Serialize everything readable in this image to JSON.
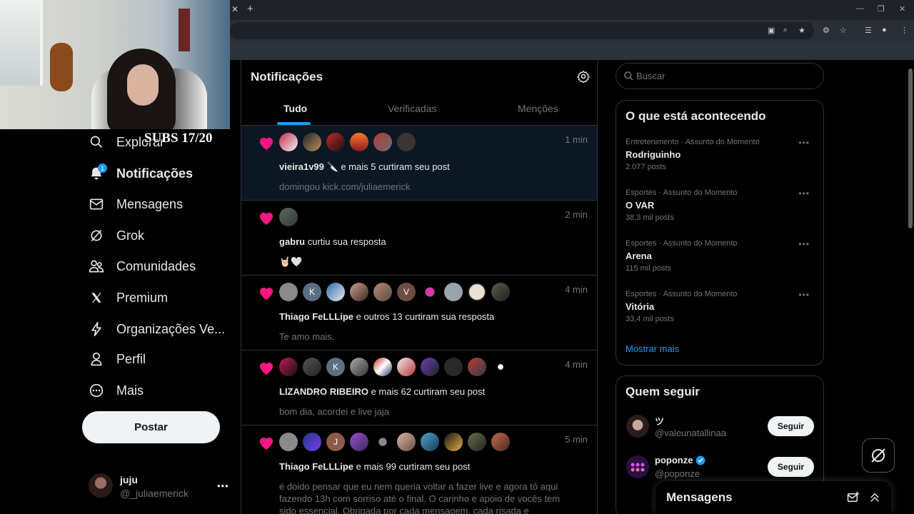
{
  "overlay": {
    "subs": "SUBS 17/20"
  },
  "nav": {
    "explore": "Explorar",
    "notifications": "Notificações",
    "notifications_badge": "1",
    "messages": "Mensagens",
    "grok": "Grok",
    "communities": "Comunidades",
    "premium": "Premium",
    "organizations": "Organizações Ve...",
    "profile": "Perfil",
    "more": "Mais",
    "post_button": "Postar"
  },
  "account": {
    "name": "juju",
    "handle": "@_juliaemerick"
  },
  "main": {
    "title": "Notificações",
    "tabs": [
      "Tudo",
      "Verificadas",
      "Menções"
    ]
  },
  "notifications": [
    {
      "time": "1 min",
      "actor": "vieira1v99",
      "emoji": "🔪",
      "action": " e mais 5 curtiram seu post",
      "sub": "domingou kick.com/juliaemerick"
    },
    {
      "time": "2 min",
      "actor": "gabru",
      "action": " curtiu sua resposta",
      "sub": "🤘🏻🤍"
    },
    {
      "time": "4 min",
      "actor": "Thiago FeLLLipe",
      "action": " e outros 13 curtiram sua resposta",
      "sub": "Te amo mais.",
      "avatar_letters": [
        "K",
        "V"
      ]
    },
    {
      "time": "4 min",
      "actor": "LIZANDRO RIBEIRO",
      "action": " e mais 62 curtiram seu post",
      "sub": "bom dia, acordei e live jaja",
      "avatar_letters": [
        "K"
      ]
    },
    {
      "time": "5 min",
      "actor": "Thiago FeLLLipe",
      "action": " e mais 99 curtiram seu post",
      "body": "é doido pensar que eu nem queria voltar a fazer live e agora tô aqui fazendo 13h com sorriso até o final. O carinho e apoio de vocês tem sido essencial. Obrigada por cada mensagem, cada risada e",
      "avatar_letters": [
        "J"
      ]
    }
  ],
  "search": {
    "placeholder": "Buscar"
  },
  "trends": {
    "title": "O que está acontecendo",
    "items": [
      {
        "category": "Entretenimento · Assunto do Momento",
        "name": "Rodriguinho",
        "count": "2.077 posts"
      },
      {
        "category": "Esportes · Assunto do Momento",
        "name": "O VAR",
        "count": "38,3 mil posts"
      },
      {
        "category": "Esportes · Assunto do Momento",
        "name": "Arena",
        "count": "115 mil posts"
      },
      {
        "category": "Esportes · Assunto do Momento",
        "name": "Vitória",
        "count": "33,4 mil posts"
      }
    ],
    "show_more": "Mostrar mais"
  },
  "who_to_follow": {
    "title": "Quem seguir",
    "items": [
      {
        "name": "ツ",
        "handle": "@valeunatallinaa",
        "button": "Seguir"
      },
      {
        "name": "poponze",
        "handle": "@poponze",
        "button": "Seguir",
        "verified": true
      }
    ]
  },
  "messages_drawer": {
    "title": "Mensagens"
  },
  "colors": {
    "accent": "#1d9bf0",
    "like": "#f91880",
    "background": "#000000",
    "border": "#2f3336",
    "muted": "#71767b"
  }
}
